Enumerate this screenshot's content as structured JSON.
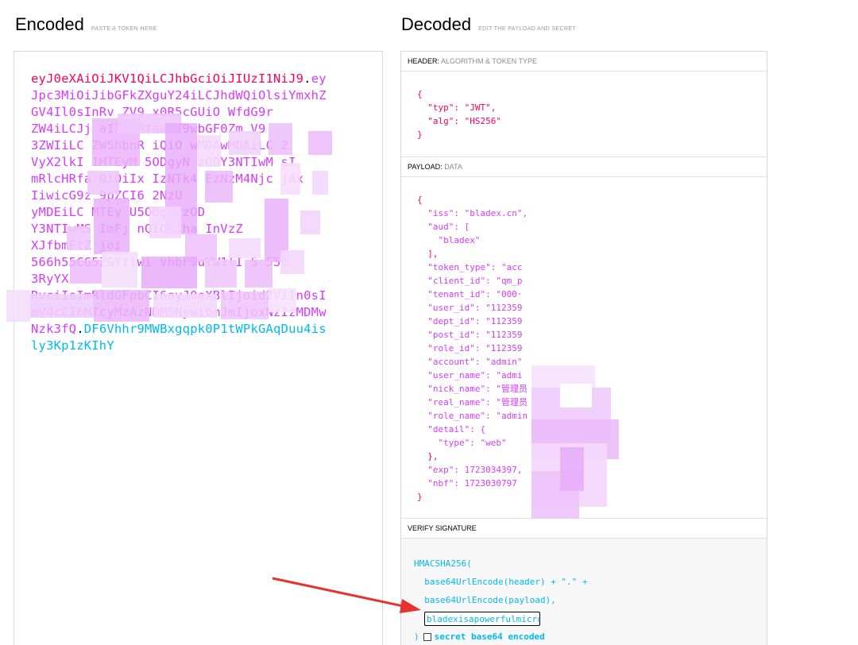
{
  "encoded": {
    "title": "Encoded",
    "hint": "PASTE A TOKEN HERE",
    "lines": [
      [
        {
          "t": "eyJ0eXAiOiJKV1QiLCJhbGciOiJIUzI1NiJ9",
          "c": "seg-header"
        },
        {
          "t": ".",
          "c": "seg-dot"
        },
        {
          "t": "ey",
          "c": "seg-payload"
        }
      ],
      [
        {
          "t": "Jpc3MiOiJibGFkZXguY24iLCJhdWQiOlsiYmxhZ",
          "c": "seg-payload"
        }
      ],
      [
        {
          "t": "GV4Il0sInRv  ZV9  x0R5cGUiO      WfdG9r",
          "c": "seg-payload"
        }
      ],
      [
        {
          "t": "ZW4iLCJj  aIlbnRfaw  V9wbGF0Zm  V9",
          "c": "seg-payload"
        }
      ],
      [
        {
          "t": "3ZWIiLC  ZW5hbnR  iQiO  wMDAwMDAiLC  2",
          "c": "seg-payload"
        }
      ],
      [
        {
          "t": "VyX2lkI   1MTEyM   5ODgyN  zODY3NTIwM  sI",
          "c": "seg-payload"
        }
      ],
      [
        {
          "t": "mRlcHRfa  QiOiIx   IzNTk4   EzNzM4Njc  jAx",
          "c": "seg-payload"
        }
      ],
      [
        {
          "t": "IiwicG9z   9pZCI6          2NzU",
          "c": "seg-payload"
        }
      ],
      [
        {
          "t": "yMDEiLC              MTEy  U5ODg   czOD",
          "c": "seg-payload"
        }
      ],
      [
        {
          "t": "Y3NTIwMS   ImFj      nQiOiJha    InVzZ",
          "c": "seg-payload"
        }
      ],
      [
        {
          "t": "XJfbmFtZ                      joi",
          "c": "seg-payload"
        }
      ],
      [
        {
          "t": "566h55CG5ZGYIiwi     vhbF9uYW1lI   5   55C",
          "c": "seg-payload"
        }
      ],
      [
        {
          "t": "                          3RyYX",
          "c": "seg-payload"
        }
      ],
      [
        {
          "t": "RvciIsImRldGFpbCI6eyJ0eXBlIjoid2ViIn0sI",
          "c": "seg-payload"
        }
      ],
      [
        {
          "t": "mV4cCI6MTcyMzAzNDM5NywibmJmIjoxNzIzMDMw",
          "c": "seg-payload"
        }
      ],
      [
        {
          "t": "Nzk3fQ",
          "c": "seg-payload"
        },
        {
          "t": ".",
          "c": "seg-dot"
        },
        {
          "t": "DF6Vhhr9MWBxgqpk0P1tWPkGAqDuu4is",
          "c": "seg-sig"
        }
      ],
      [
        {
          "t": "ly3Kp1zKIhY",
          "c": "seg-sig"
        }
      ]
    ]
  },
  "decoded": {
    "title": "Decoded",
    "hint": "EDIT THE PAYLOAD AND SECRET",
    "header_panel": {
      "label": "HEADER:",
      "sublabel": "ALGORITHM & TOKEN TYPE",
      "lines": [
        "{",
        "  \"typ\": \"JWT\",",
        "  \"alg\": \"HS256\"",
        "}"
      ]
    },
    "payload_panel": {
      "label": "PAYLOAD:",
      "sublabel": "DATA",
      "lines": [
        "{",
        "  \"iss\": \"bladex.cn\",",
        "  \"aud\": [",
        "    \"bladex\"",
        "  ],",
        "  \"token_type\": \"acc",
        "  \"client_id\": \"qm_p",
        "  \"tenant_id\": \"000·",
        "  \"user_id\": \"112359",
        "  \"dept_id\": \"112359",
        "  \"post_id\": \"112359",
        "  \"role_id\": \"112359",
        "  \"account\": \"admin\"",
        "  \"user_name\": \"admi",
        "  \"nick_name\": \"管理员",
        "  \"real_name\": \"管理员",
        "  \"role_name\": \"admin",
        "  \"detail\": {",
        "    \"type\": \"web\"",
        "  },",
        "  \"exp\": 1723034397,",
        "  \"nbf\": 1723030797",
        "}"
      ]
    },
    "verify_panel": {
      "label": "VERIFY SIGNATURE",
      "fn": "HMACSHA256(",
      "line1": "  base64UrlEncode(header) + \".\" +",
      "line2": "  base64UrlEncode(payload),",
      "secret_value": "bladexisapowerfulmicro",
      "close": ")",
      "checkbox_label": "secret base64 encoded"
    }
  },
  "colors": {
    "header": "#fb015b",
    "payload": "#d63aff",
    "signature": "#00b9f1",
    "arrow": "#e8322d"
  }
}
